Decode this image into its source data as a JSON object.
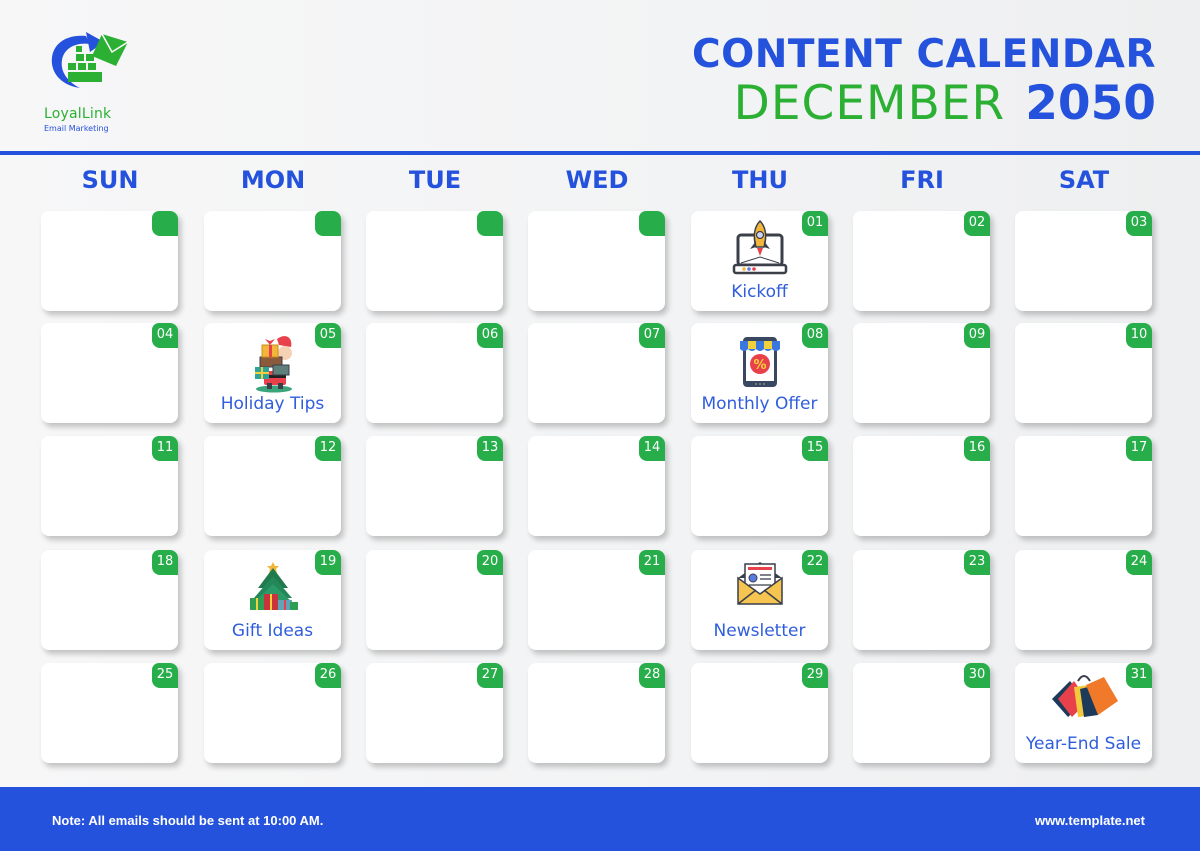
{
  "brand": {
    "name": "LoyalLink",
    "tagline": "Email Marketing",
    "colors": {
      "primary_blue": "#2552dc",
      "green": "#2cb034",
      "badge_green": "#27ae4a"
    }
  },
  "header": {
    "title": "CONTENT CALENDAR",
    "month": "DECEMBER",
    "year": "2050"
  },
  "weekdays": [
    "SUN",
    "MON",
    "TUE",
    "WED",
    "THU",
    "FRI",
    "SAT"
  ],
  "weeks": [
    [
      {
        "day": "",
        "event": null
      },
      {
        "day": "",
        "event": null
      },
      {
        "day": "",
        "event": null
      },
      {
        "day": "",
        "event": null
      },
      {
        "day": "01",
        "event": {
          "label": "Kickoff",
          "icon": "rocket-laptop-icon"
        }
      },
      {
        "day": "02",
        "event": null
      },
      {
        "day": "03",
        "event": null
      }
    ],
    [
      {
        "day": "04",
        "event": null
      },
      {
        "day": "05",
        "event": {
          "label": "Holiday Tips",
          "icon": "santa-gifts-icon"
        }
      },
      {
        "day": "06",
        "event": null
      },
      {
        "day": "07",
        "event": null
      },
      {
        "day": "08",
        "event": {
          "label": "Monthly Offer",
          "icon": "shop-discount-icon"
        }
      },
      {
        "day": "09",
        "event": null
      },
      {
        "day": "10",
        "event": null
      }
    ],
    [
      {
        "day": "11",
        "event": null
      },
      {
        "day": "12",
        "event": null
      },
      {
        "day": "13",
        "event": null
      },
      {
        "day": "14",
        "event": null
      },
      {
        "day": "15",
        "event": null
      },
      {
        "day": "16",
        "event": null
      },
      {
        "day": "17",
        "event": null
      }
    ],
    [
      {
        "day": "18",
        "event": null
      },
      {
        "day": "19",
        "event": {
          "label": "Gift Ideas",
          "icon": "christmas-tree-icon"
        }
      },
      {
        "day": "20",
        "event": null
      },
      {
        "day": "21",
        "event": null
      },
      {
        "day": "22",
        "event": {
          "label": "Newsletter",
          "icon": "envelope-letter-icon"
        }
      },
      {
        "day": "23",
        "event": null
      },
      {
        "day": "24",
        "event": null
      }
    ],
    [
      {
        "day": "25",
        "event": null
      },
      {
        "day": "26",
        "event": null
      },
      {
        "day": "27",
        "event": null
      },
      {
        "day": "28",
        "event": null
      },
      {
        "day": "29",
        "event": null
      },
      {
        "day": "30",
        "event": null
      },
      {
        "day": "31",
        "event": {
          "label": "Year-End Sale",
          "icon": "shopping-bags-icon"
        }
      }
    ]
  ],
  "footer": {
    "note": "Note: All emails should be sent at 10:00 AM.",
    "website": "www.template.net"
  }
}
